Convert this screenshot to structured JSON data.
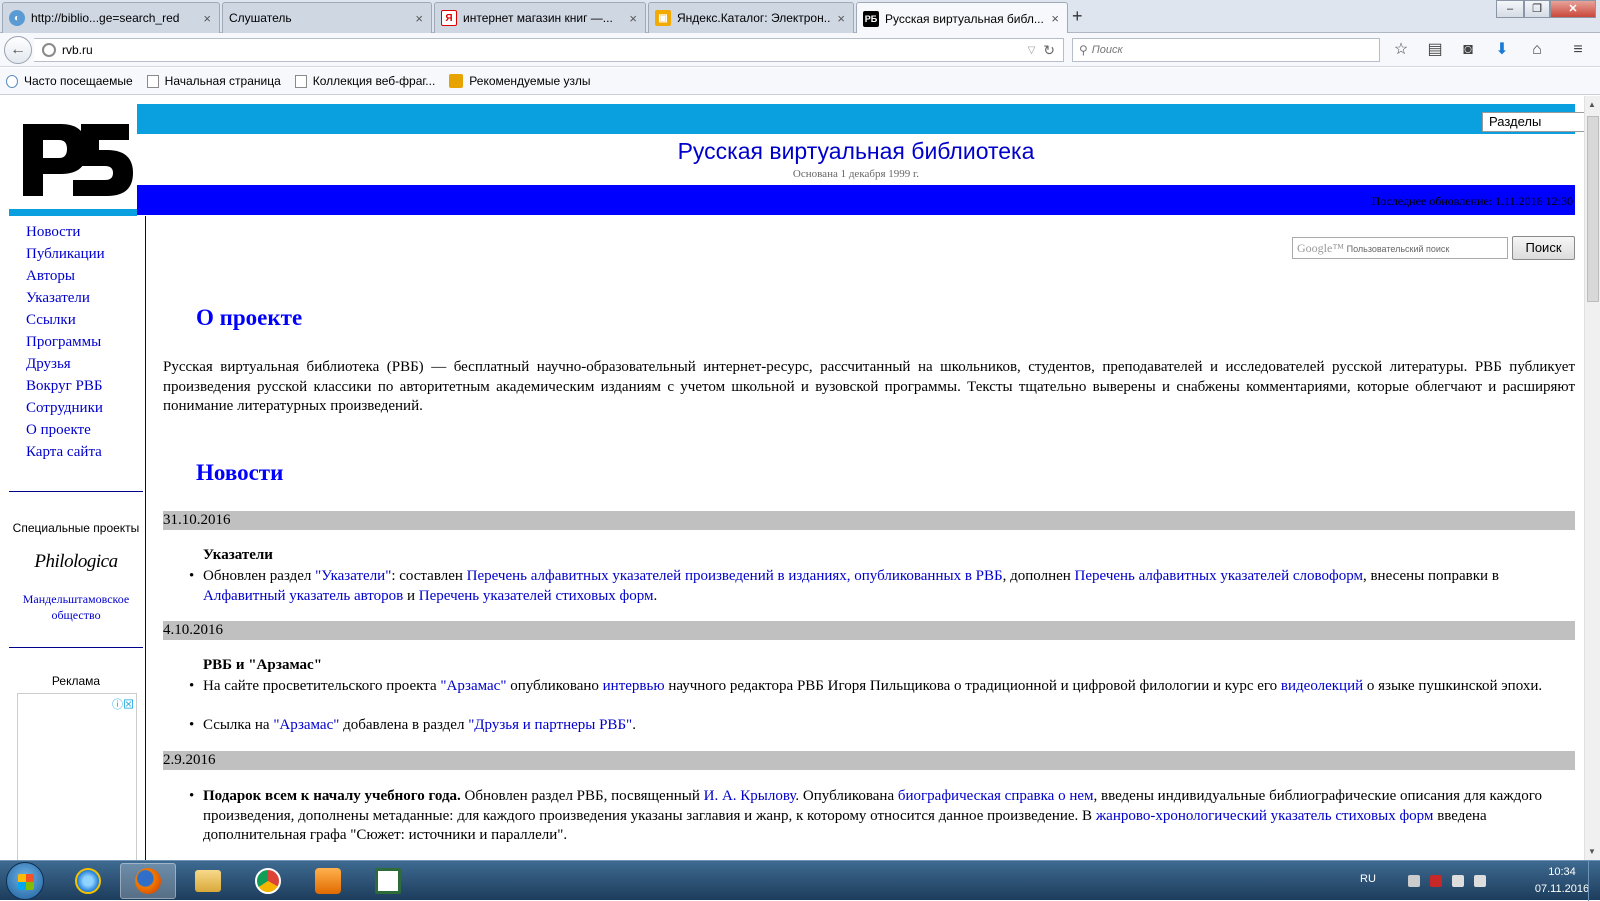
{
  "browser": {
    "tabs": [
      {
        "title": "http://biblio...ge=search_red",
        "icon": "globe-icon"
      },
      {
        "title": "Слушатель",
        "icon": "blank-icon"
      },
      {
        "title": "интернет магазин книг —...",
        "icon": "yandex-icon"
      },
      {
        "title": "Яндекс.Каталог: Электрон...",
        "icon": "bookmark-icon"
      },
      {
        "title": "Русская виртуальная библ...",
        "icon": "rvb-icon"
      }
    ],
    "active_tab": 4,
    "url": "rvb.ru",
    "search_placeholder": "Поиск",
    "bookmarks": [
      {
        "label": "Часто посещаемые"
      },
      {
        "label": "Начальная страница"
      },
      {
        "label": "Коллекция веб-фраг..."
      },
      {
        "label": "Рекомендуемые узлы"
      }
    ]
  },
  "site": {
    "logo_text": "РБ",
    "title": "Русская виртуальная библиотека",
    "subtitle": "Основана 1 декабря 1999 г.",
    "last_update": "Последнее обновление: 1.11.2016 12:30",
    "sections_select": "Разделы",
    "google_label": "Google™",
    "google_placeholder": "Пользовательский поиск",
    "search_button": "Поиск"
  },
  "nav": [
    "Новости",
    "Публикации",
    "Авторы",
    "Указатели",
    "Ссылки",
    "Программы",
    "Друзья",
    "Вокруг РВБ",
    "Сотрудники",
    "О проекте",
    "Карта сайта"
  ],
  "sidebar": {
    "special_title": "Специальные проекты",
    "philologica": "Philologica",
    "mandelstam": "Мандельштамовское общество",
    "ads_title": "Реклама"
  },
  "about": {
    "heading": "О проекте",
    "text": "Русская виртуальная библиотека (РВБ) — бесплатный научно-образовательный интернет-ресурс, рассчитанный на школьников, студентов, преподавателей и исследователей русской литературы. РВБ публикует произведения русской классики по авторитетным академическим изданиям с учетом школьной и вузовской программы. Тексты тщательно выверены и снабжены комментариями, которые облегчают и расширяют понимание литературных произведений."
  },
  "news": {
    "heading": "Новости",
    "d1": {
      "date": "31.10.2016",
      "head": "Указатели",
      "p1": "Обновлен раздел ",
      "l1": "\"Указатели\"",
      "p2": ": составлен ",
      "l2": "Перечень алфавитных указателей произведений в изданиях, опубликованных в РВБ",
      "p3": ", дополнен ",
      "l3": "Перечень алфавитных указателей словоформ",
      "p4": ", внесены поправки в ",
      "l4": "Алфавитный указатель авторов",
      "p5": " и ",
      "l5": "Перечень указателей стиховых форм",
      "p6": "."
    },
    "d2": {
      "date": "4.10.2016",
      "head": "РВБ и \"Арзамас\"",
      "a1": "На сайте просветительского проекта ",
      "a2": "\"Арзамас\"",
      "a3": " опубликовано ",
      "a4": "интервью",
      "a5": " научного редактора РВБ Игоря Пильщикова о традиционной и цифровой филологии и курс его ",
      "a6": "видеолекций",
      "a7": " о языке пушкинской эпохи.",
      "b1": "Ссылка на ",
      "b2": "\"Арзамас\"",
      "b3": " добавлена в раздел ",
      "b4": "\"Друзья и партнеры РВБ\"",
      "b5": "."
    },
    "d3": {
      "date": "2.9.2016",
      "bold": "Подарок всем к началу учебного года.",
      "t1": " Обновлен раздел РВБ, посвященный ",
      "l1": "И. А. Крылову",
      "t2": ". Опубликована ",
      "l2": "биографическая справка о нем",
      "t3": ", введены индивидуальные библиографические описания для каждого произведения, дополнены метаданные: для каждого произведения указаны заглавия и жанр, к которому относится данное произведение. В ",
      "l3": "жанрово-хронологический указатель стиховых форм",
      "t4": " введена дополнительная графа \"Сюжет: источники и параллели\"."
    }
  },
  "taskbar": {
    "apps": [
      "internet-explorer-icon",
      "firefox-icon",
      "file-explorer-icon",
      "chrome-icon",
      "media-player-icon",
      "presentation-icon"
    ],
    "active_app": "firefox-icon",
    "lang": "RU",
    "time": "10:34",
    "date": "07.11.2016"
  },
  "colors": {
    "accent_cyan": "#0aa0e0",
    "accent_blue": "#0000ff",
    "link": "#0000cc",
    "date_bar": "#c0c0c0"
  }
}
